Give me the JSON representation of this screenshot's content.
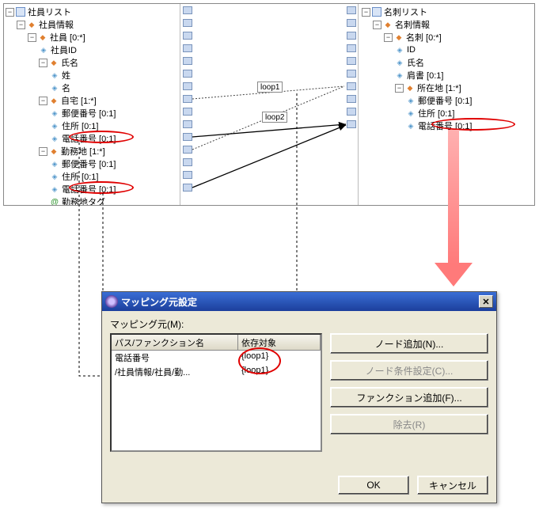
{
  "left_tree": {
    "root": "社員リスト",
    "items": [
      "社員情報",
      "社員 [0:*]",
      "社員ID",
      "氏名",
      "姓",
      "名",
      "自宅 [1:*]",
      "郵便番号 [0:1]",
      "住所 [0:1]",
      "電話番号 [0:1]",
      "勤務地 [1:*]",
      "郵便番号 [0:1]",
      "住所 [0:1]",
      "電話番号 [0:1]",
      "勤務地タグ"
    ]
  },
  "right_tree": {
    "root": "名刺リスト",
    "items": [
      "名刺情報",
      "名刺 [0:*]",
      "ID",
      "氏名",
      "肩書 [0:1]",
      "所在地 [1:*]",
      "郵便番号 [0:1]",
      "住所 [0:1]",
      "電話番号 [0:1]"
    ]
  },
  "loops": {
    "loop1": "loop1",
    "loop2": "loop2"
  },
  "dialog": {
    "title": "マッピング元設定",
    "label": "マッピング元(M):",
    "columns": {
      "path": "パス/ファンクション名",
      "depends": "依存対象"
    },
    "rows": [
      {
        "path": "電話番号",
        "depends": "{loop1}"
      },
      {
        "path": "/社員情報/社員/勤...",
        "depends": "{loop1}"
      }
    ],
    "buttons": {
      "add_node": "ノード追加(N)...",
      "node_cond": "ノード条件設定(C)...",
      "add_func": "ファンクション追加(F)...",
      "remove": "除去(R)",
      "ok": "OK",
      "cancel": "キャンセル"
    }
  }
}
